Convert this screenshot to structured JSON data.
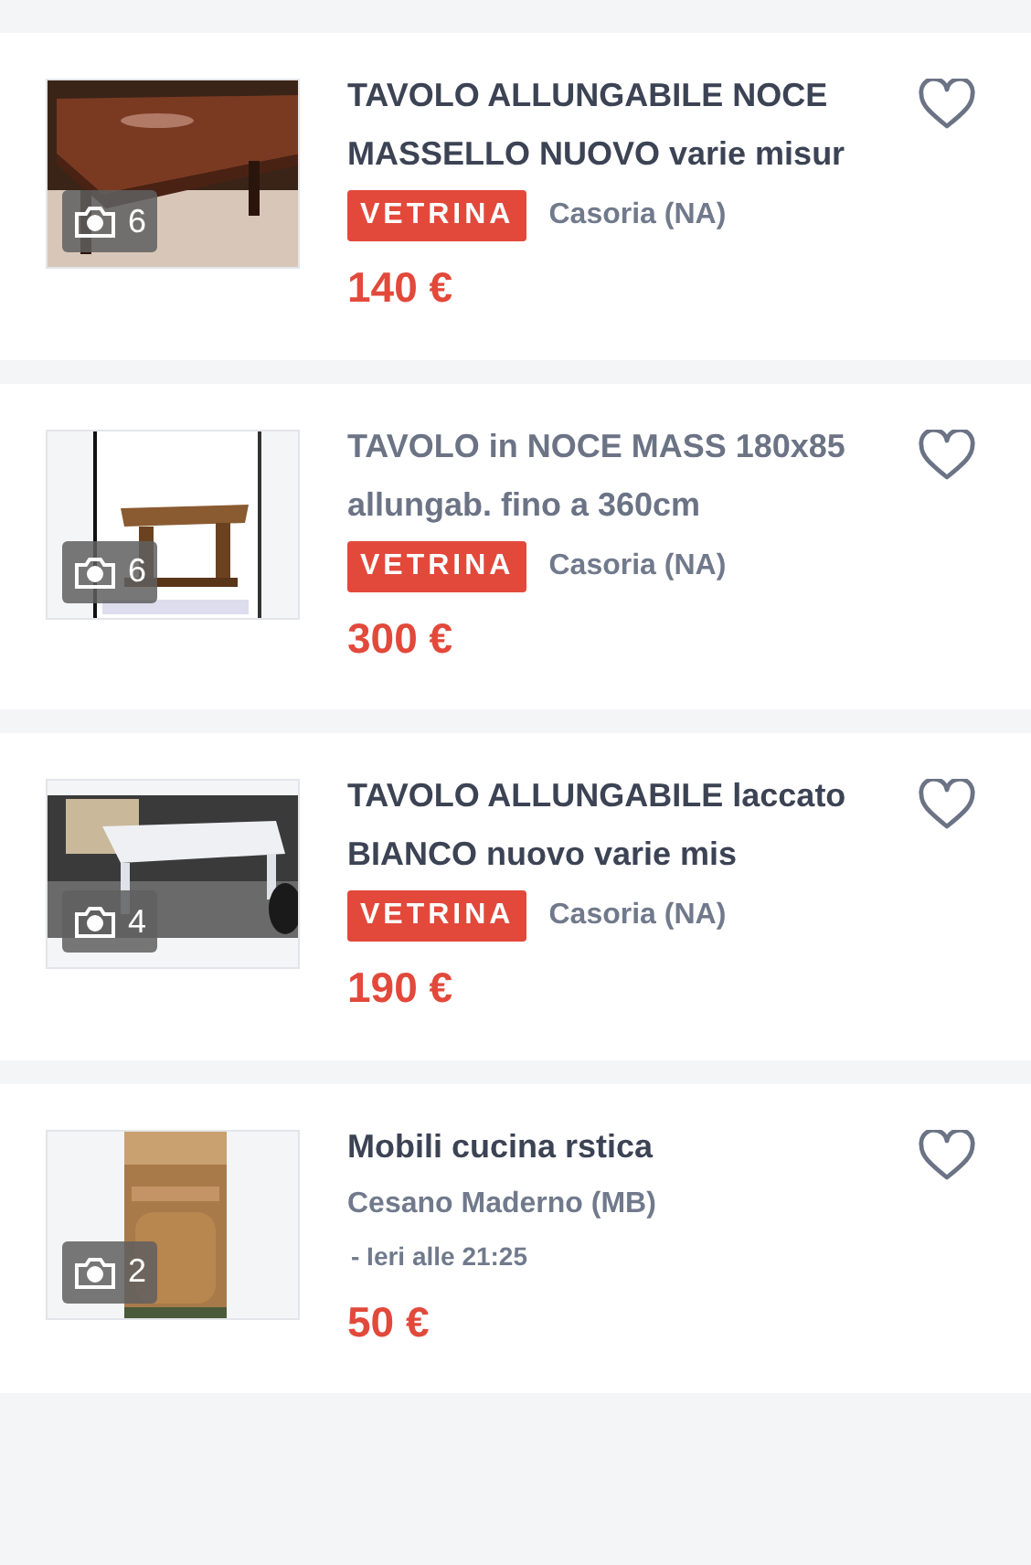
{
  "listings": [
    {
      "title": "TAVOLO ALLUNGABILE NOCE MASSELLO NUOVO varie misur",
      "visited": false,
      "photo_count": "6",
      "badge": "VETRINA",
      "location": "Casoria (NA)",
      "price": "140 €",
      "favorite": false
    },
    {
      "title": "TAVOLO in NOCE MASS 180x85 allungab. fino a 360cm",
      "visited": true,
      "photo_count": "6",
      "badge": "VETRINA",
      "location": "Casoria (NA)",
      "price": "300 €",
      "favorite": false
    },
    {
      "title": "TAVOLO ALLUNGABILE laccato BIANCO nuovo varie mis",
      "visited": false,
      "photo_count": "4",
      "badge": "VETRINA",
      "location": "Casoria (NA)",
      "price": "190 €",
      "favorite": false
    },
    {
      "title": "Mobili cucina rstica",
      "visited": false,
      "photo_count": "2",
      "location": "Cesano Maderno (MB)",
      "date": "- Ieri alle 21:25",
      "price": "50 €",
      "favorite": false
    }
  ]
}
